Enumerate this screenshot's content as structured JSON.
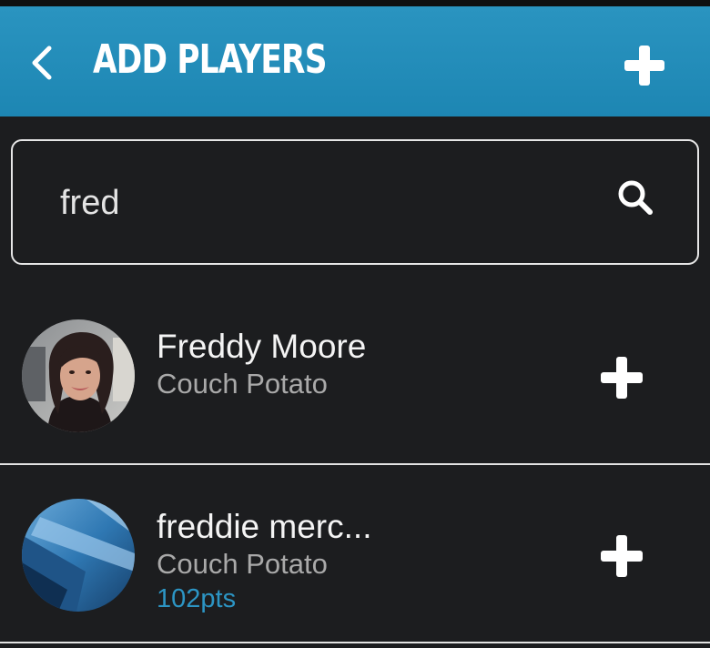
{
  "colors": {
    "header_bg": "#1d86b3",
    "page_bg": "#1c1d1f",
    "points_accent": "#2c95c4"
  },
  "header": {
    "title": "ADD PLAYERS",
    "back_icon": "chevron-left-icon",
    "add_icon": "plus-icon"
  },
  "search": {
    "value": "fred",
    "icon": "search-icon"
  },
  "players": [
    {
      "name": "Freddy Moore",
      "rank": "Couch Potato",
      "points": "",
      "avatar": "person-photo",
      "add_icon": "plus-icon"
    },
    {
      "name": "freddie merc...",
      "rank": "Couch Potato",
      "points": "102pts",
      "avatar": "blue-abstract-photo",
      "add_icon": "plus-icon"
    }
  ]
}
